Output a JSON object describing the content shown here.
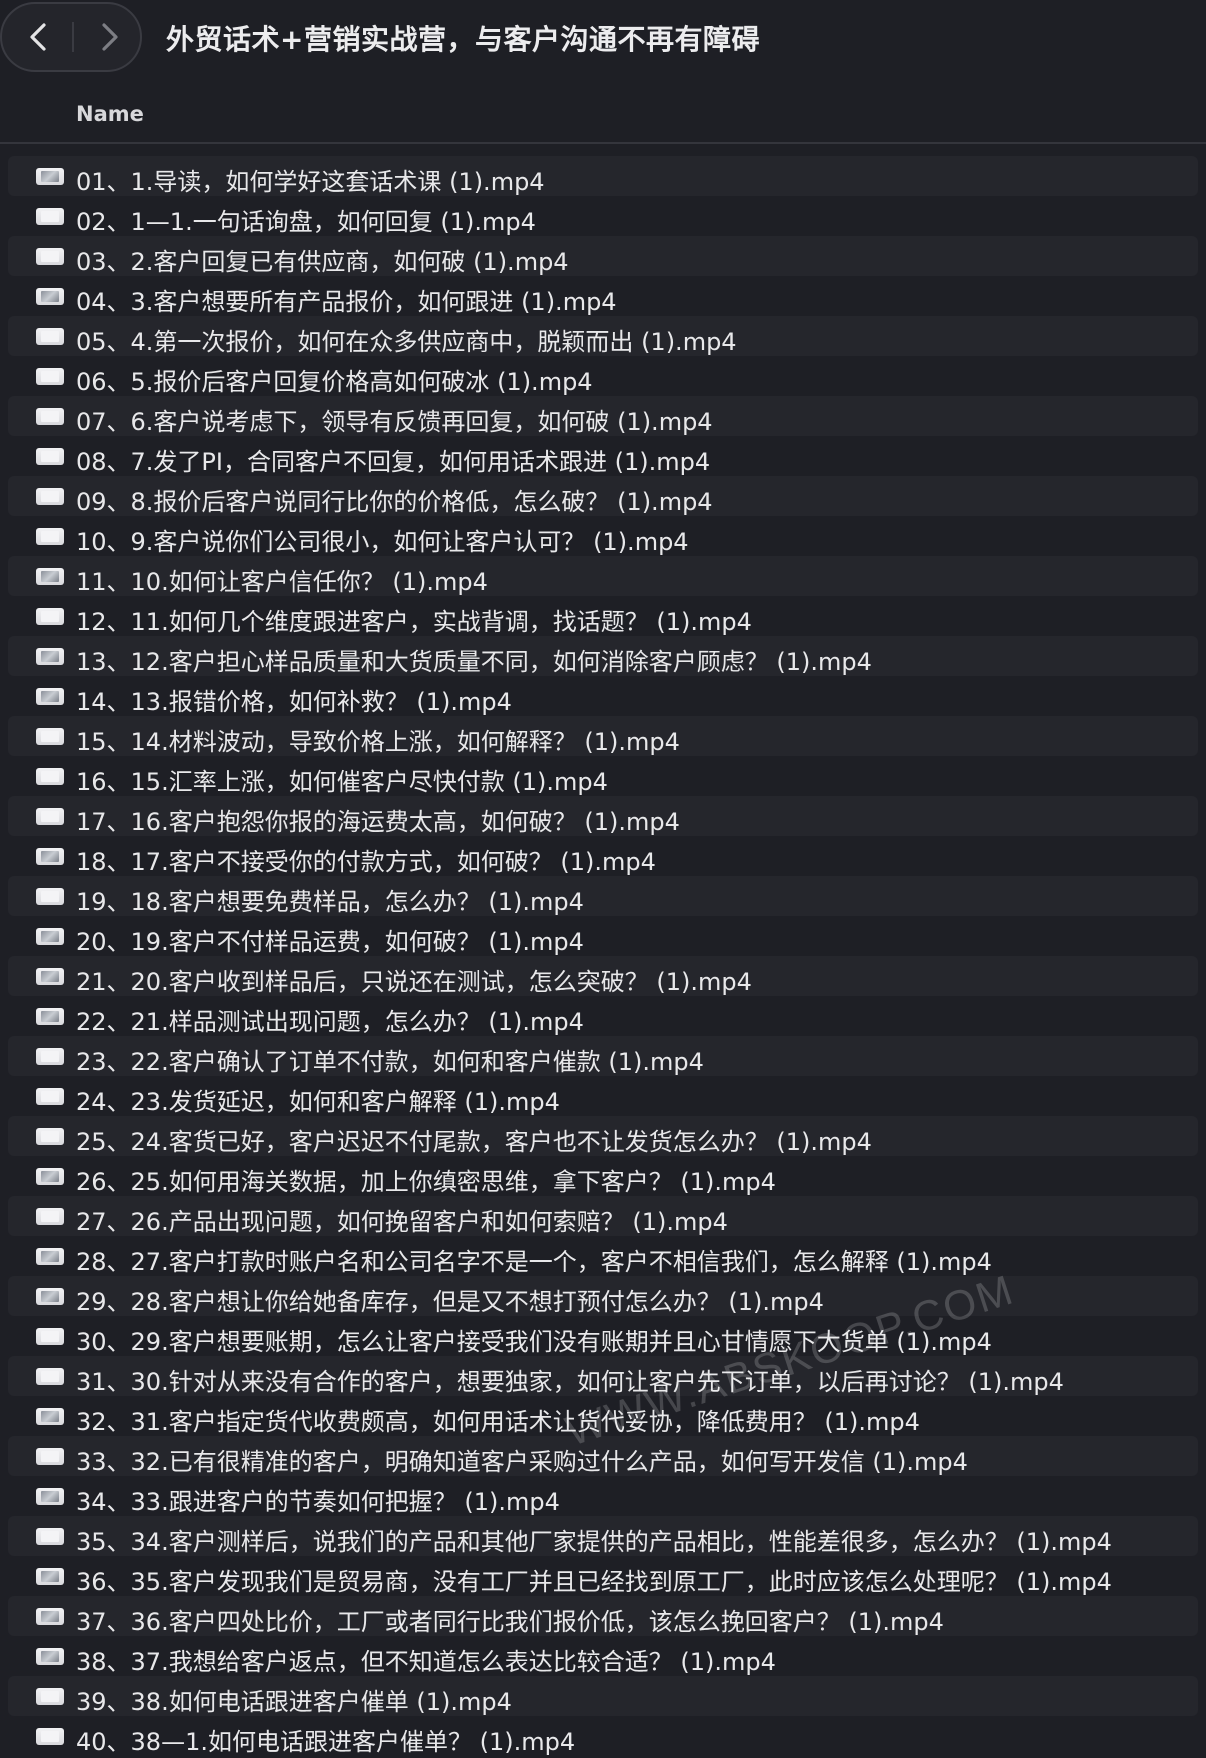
{
  "window": {
    "title": "外贸话术+营销实战营，与客户沟通不再有障碍"
  },
  "nav": {
    "back_icon": "chevron-left-icon",
    "forward_icon": "chevron-right-icon"
  },
  "columns": {
    "name": "Name"
  },
  "files": [
    {
      "name": "01、1.导读，如何学好这套话术课 (1).mp4",
      "thumb": true
    },
    {
      "name": "02、1—1.一句话询盘，如何回复 (1).mp4",
      "thumb": false
    },
    {
      "name": "03、2.客户回复已有供应商，如何破 (1).mp4",
      "thumb": false
    },
    {
      "name": "04、3.客户想要所有产品报价，如何跟进 (1).mp4",
      "thumb": true
    },
    {
      "name": "05、4.第一次报价，如何在众多供应商中，脱颖而出 (1).mp4",
      "thumb": false
    },
    {
      "name": "06、5.报价后客户回复价格高如何破冰 (1).mp4",
      "thumb": false
    },
    {
      "name": "07、6.客户说考虑下，领导有反馈再回复，如何破 (1).mp4",
      "thumb": false
    },
    {
      "name": "08、7.发了PI，合同客户不回复，如何用话术跟进 (1).mp4",
      "thumb": false
    },
    {
      "name": "09、8.报价后客户说同行比你的价格低，怎么破？ (1).mp4",
      "thumb": false
    },
    {
      "name": "10、9.客户说你们公司很小，如何让客户认可？ (1).mp4",
      "thumb": false
    },
    {
      "name": "11、10.如何让客户信任你？ (1).mp4",
      "thumb": true
    },
    {
      "name": "12、11.如何几个维度跟进客户，实战背调，找话题？ (1).mp4",
      "thumb": false
    },
    {
      "name": "13、12.客户担心样品质量和大货质量不同，如何消除客户顾虑？ (1).mp4",
      "thumb": true
    },
    {
      "name": "14、13.报错价格，如何补救？ (1).mp4",
      "thumb": true
    },
    {
      "name": "15、14.材料波动，导致价格上涨，如何解释？ (1).mp4",
      "thumb": false
    },
    {
      "name": "16、15.汇率上涨，如何催客户尽快付款 (1).mp4",
      "thumb": false
    },
    {
      "name": "17、16.客户抱怨你报的海运费太高，如何破？ (1).mp4",
      "thumb": false
    },
    {
      "name": "18、17.客户不接受你的付款方式，如何破？ (1).mp4",
      "thumb": true
    },
    {
      "name": "19、18.客户想要免费样品，怎么办？ (1).mp4",
      "thumb": false
    },
    {
      "name": "20、19.客户不付样品运费，如何破？ (1).mp4",
      "thumb": true
    },
    {
      "name": "21、20.客户收到样品后，只说还在测试，怎么突破？ (1).mp4",
      "thumb": true
    },
    {
      "name": "22、21.样品测试出现问题，怎么办？ (1).mp4",
      "thumb": true
    },
    {
      "name": "23、22.客户确认了订单不付款，如何和客户催款 (1).mp4",
      "thumb": false
    },
    {
      "name": "24、23.发货延迟，如何和客户解释 (1).mp4",
      "thumb": false
    },
    {
      "name": "25、24.客货已好，客户迟迟不付尾款，客户也不让发货怎么办？ (1).mp4",
      "thumb": false
    },
    {
      "name": "26、25.如何用海关数据，加上你缜密思维，拿下客户？ (1).mp4",
      "thumb": true
    },
    {
      "name": "27、26.产品出现问题，如何挽留客户和如何索赔？ (1).mp4",
      "thumb": false
    },
    {
      "name": "28、27.客户打款时账户名和公司名字不是一个，客户不相信我们，怎么解释 (1).mp4",
      "thumb": true
    },
    {
      "name": "29、28.客户想让你给她备库存，但是又不想打预付怎么办？ (1).mp4",
      "thumb": true
    },
    {
      "name": "30、29.客户想要账期，怎么让客户接受我们没有账期并且心甘情愿下大货单 (1).mp4",
      "thumb": false
    },
    {
      "name": "31、30.针对从来没有合作的客户，想要独家，如何让客户先下订单，以后再讨论？ (1).mp4",
      "thumb": false
    },
    {
      "name": "32、31.客户指定货代收费颇高，如何用话术让货代妥协，降低费用？ (1).mp4",
      "thumb": true
    },
    {
      "name": "33、32.已有很精准的客户，明确知道客户采购过什么产品，如何写开发信 (1).mp4",
      "thumb": false
    },
    {
      "name": "34、33.跟进客户的节奏如何把握？ (1).mp4",
      "thumb": true
    },
    {
      "name": "35、34.客户测样后，说我们的产品和其他厂家提供的产品相比，性能差很多，怎么办？ (1).mp4",
      "thumb": false
    },
    {
      "name": "36、35.客户发现我们是贸易商，没有工厂并且已经找到原工厂，此时应该怎么处理呢？ (1).mp4",
      "thumb": true
    },
    {
      "name": "37、36.客户四处比价，工厂或者同行比我们报价低，该怎么挽回客户？ (1).mp4",
      "thumb": true
    },
    {
      "name": "38、37.我想给客户返点，但不知道怎么表达比较合适？ (1).mp4",
      "thumb": true
    },
    {
      "name": "39、38.如何电话跟进客户催单 (1).mp4",
      "thumb": false
    },
    {
      "name": "40、38—1.如何电话跟进客户催单？ (1).mp4",
      "thumb": false
    }
  ],
  "watermark": "WWW.ABSKOOP.COM"
}
